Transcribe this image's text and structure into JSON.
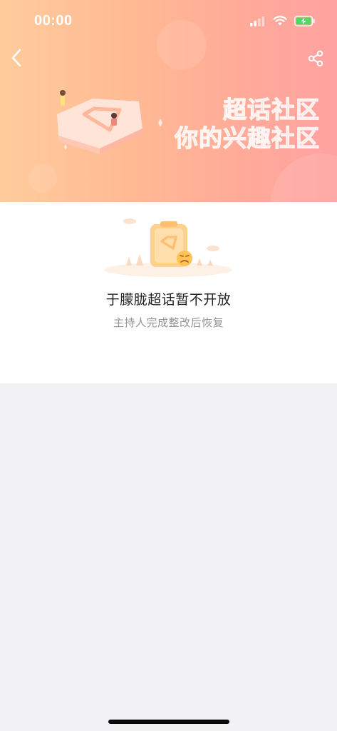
{
  "status_bar": {
    "time": "00:00",
    "icons": [
      "signal-icon",
      "wifi-icon",
      "battery-charging-icon"
    ]
  },
  "nav": {
    "back_icon": "chevron-left-icon",
    "share_icon": "share-icon"
  },
  "banner": {
    "slogan_line1": "超话社区",
    "slogan_line2": "你的兴趣社区",
    "gradient_start": "#ffcc9c",
    "gradient_end": "#ffa2a0"
  },
  "notice": {
    "title": "于朦胧超话暂不开放",
    "subtitle": "主持人完成整改后恢复"
  },
  "colors": {
    "page_background": "#f2f2f4",
    "card_background": "#ffffff",
    "title_text": "#222222",
    "subtitle_text": "#939393",
    "battery_green": "#4cd964"
  }
}
